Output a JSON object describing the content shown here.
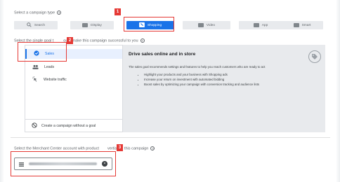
{
  "campaign_type": {
    "prompt": "Select a campaign type",
    "help_glyph": "?",
    "options": [
      {
        "label": "Search",
        "icon": "search-icon"
      },
      {
        "label": "Display",
        "icon": "display-icon"
      },
      {
        "label": "Shopping",
        "icon": "shopping-tag-icon",
        "selected": true
      },
      {
        "label": "Video",
        "icon": "video-icon"
      },
      {
        "label": "App",
        "icon": "app-icon"
      },
      {
        "label": "Smart",
        "icon": "smart-icon"
      }
    ]
  },
  "goal": {
    "prompt_before": "Select the single goal t",
    "prompt_after": "ould make this campaign successful to you",
    "help_glyph": "?",
    "items": [
      {
        "label": "Sales",
        "icon": "sales-icon",
        "selected": true
      },
      {
        "label": "Leads",
        "icon": "leads-icon"
      },
      {
        "label": "Website traffic",
        "icon": "website-traffic-icon"
      }
    ],
    "no_goal_label": "Create a campaign without a goal",
    "detail": {
      "title": "Drive sales online and in store",
      "description": "The sales goal recommends settings and features to help you reach customers who are ready to act",
      "bullets": [
        "Highlight your products and your business with Shopping ads",
        "Increase your return on investment with automated bidding",
        "Boost sales by optimizing your campaign with conversion tracking and audience lists"
      ],
      "icon": "tag-icon"
    }
  },
  "merchant": {
    "prompt_before": "Select the Merchant Center account with product",
    "prompt_after": "vertise in this campaign",
    "help_glyph": "?",
    "field_icon": "store-icon",
    "clear_glyph": "×"
  },
  "annotations": {
    "badge_1": "1",
    "badge_2": "2",
    "badge_3": "3"
  },
  "colors": {
    "accent": "#1a73e8",
    "annotation_red": "#e53935",
    "panel_gray": "#e8eaed"
  }
}
